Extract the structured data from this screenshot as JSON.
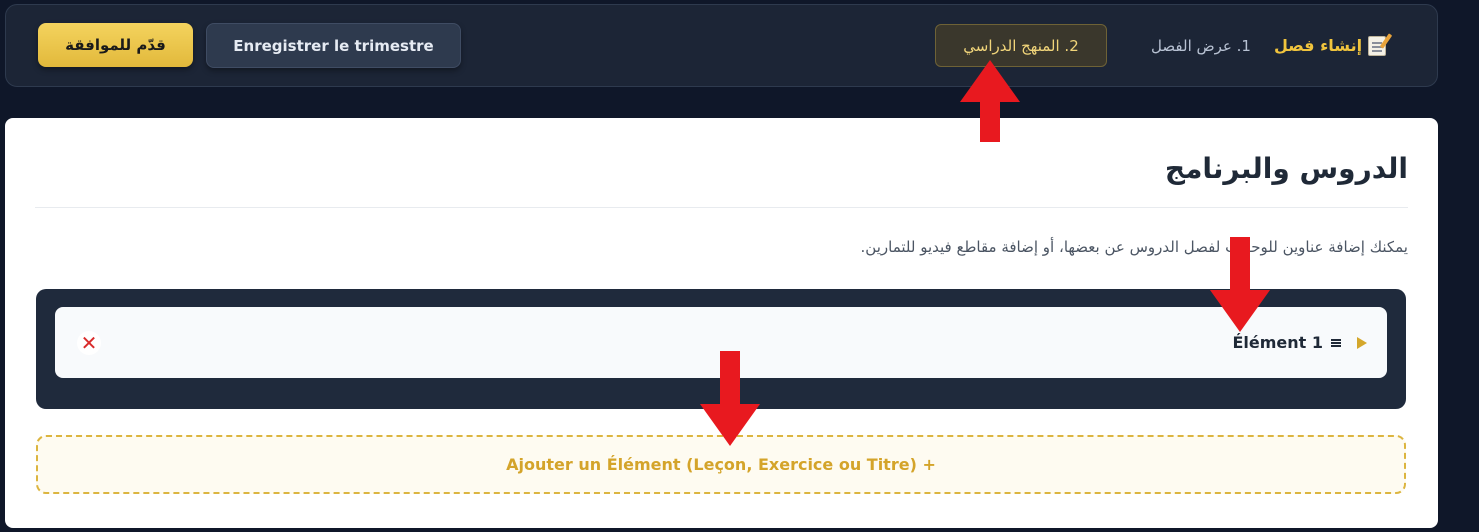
{
  "header": {
    "brand": "إنشاء فصل",
    "brand_icon": "memo-icon",
    "steps": [
      {
        "label": "1. عرض الفصل",
        "active": false
      },
      {
        "label": "2. المنهج الدراسي",
        "active": true
      }
    ],
    "save_label": "Enregistrer le trimestre",
    "submit_label": "قدّم للموافقة"
  },
  "main": {
    "title": "الدروس والبرنامج",
    "description": "يمكنك إضافة عناوين للوحدات لفصل الدروس عن بعضها، أو إضافة مقاطع فيديو للتمارين.",
    "items": [
      {
        "label": "Élément 1"
      }
    ],
    "add_label": "Ajouter un Élément (Leçon, Exercice ou Titre) +"
  },
  "colors": {
    "accent": "#f0c43d",
    "background": "#0f1729",
    "panel": "#1f2a3c",
    "annotation": "#e8191f"
  }
}
